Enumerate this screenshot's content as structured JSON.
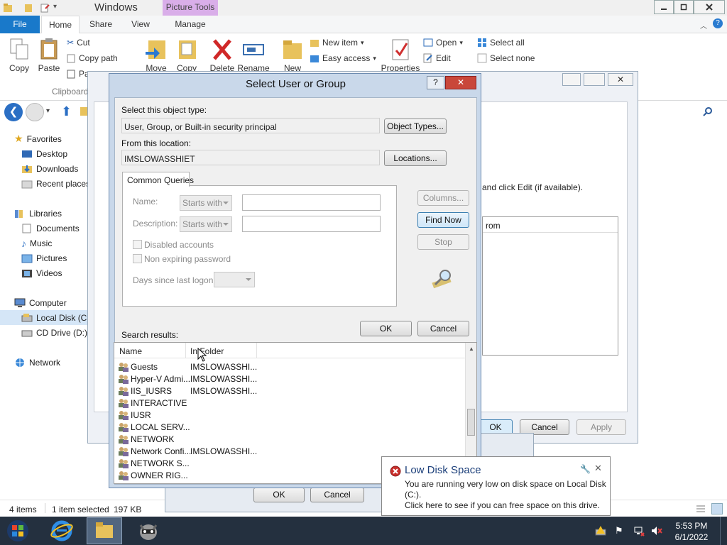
{
  "explorer": {
    "title": "Windows",
    "picture_tools": "Picture Tools",
    "tabs": [
      "File",
      "Home",
      "Share",
      "View",
      "Manage"
    ],
    "ribbon": {
      "copy": "Copy",
      "paste": "Paste",
      "cut": "Cut",
      "copy_path": "Copy path",
      "paste_shortcut": "Pa",
      "clipboard_group": "Clipboard",
      "move": "Move",
      "copy_to": "Copy",
      "delete": "Delete",
      "rename": "Rename",
      "new": "New",
      "new_item": "New item",
      "easy_access": "Easy access",
      "properties": "Properties",
      "open": "Open",
      "edit": "Edit",
      "select_all": "Select all",
      "select_none": "Select none"
    },
    "nav": {
      "favorites": "Favorites",
      "desktop": "Desktop",
      "downloads": "Downloads",
      "recent": "Recent places",
      "libraries": "Libraries",
      "documents": "Documents",
      "music": "Music",
      "pictures": "Pictures",
      "videos": "Videos",
      "computer": "Computer",
      "local_disk": "Local Disk (C:)",
      "cd_drive": "CD Drive (D:)",
      "network": "Network"
    },
    "status": {
      "items": "4 items",
      "selected": "1 item selected",
      "size": "197 KB"
    }
  },
  "props_window": {
    "instruction": "and click Edit (if available).",
    "column": "rom",
    "ok": "OK",
    "cancel": "Cancel",
    "apply": "Apply"
  },
  "adv_window": {
    "ok": "OK",
    "cancel": "Cancel"
  },
  "dialog": {
    "title": "Select User or Group",
    "object_type_label": "Select this object type:",
    "object_type_value": "User, Group, or Built-in security principal",
    "object_types_btn": "Object Types...",
    "location_label": "From this location:",
    "location_value": "IMSLOWASSHIET",
    "locations_btn": "Locations...",
    "queries_tab": "Common Queries",
    "name_label": "Name:",
    "desc_label": "Description:",
    "starts_with": "Starts with",
    "disabled_accounts": "Disabled accounts",
    "non_expiring": "Non expiring password",
    "days_label": "Days since last logon:",
    "columns_btn": "Columns...",
    "find_now_btn": "Find Now",
    "stop_btn": "Stop",
    "ok_btn": "OK",
    "cancel_btn": "Cancel",
    "results_label": "Search results:",
    "col_name": "Name",
    "col_folder": "In Folder",
    "rows": [
      {
        "name": "Guests",
        "folder": "IMSLOWASSHI..."
      },
      {
        "name": "Hyper-V Admi...",
        "folder": "IMSLOWASSHI..."
      },
      {
        "name": "IIS_IUSRS",
        "folder": "IMSLOWASSHI..."
      },
      {
        "name": "INTERACTIVE",
        "folder": ""
      },
      {
        "name": "IUSR",
        "folder": ""
      },
      {
        "name": "LOCAL SERV...",
        "folder": ""
      },
      {
        "name": "NETWORK",
        "folder": ""
      },
      {
        "name": "Network Confi...",
        "folder": "IMSLOWASSHI..."
      },
      {
        "name": "NETWORK S...",
        "folder": ""
      },
      {
        "name": "OWNER RIG...",
        "folder": ""
      }
    ]
  },
  "notification": {
    "title": "Low Disk Space",
    "line1": "You are running very low on disk space on Local Disk",
    "line2": "(C:).",
    "line3": "Click here to see if you can free space on this drive."
  },
  "taskbar": {
    "time": "5:53 PM",
    "date": "6/1/2022"
  },
  "colors": {
    "accent": "#1979ca",
    "taskbar": "#24303f",
    "picture_tools": "#d9aee9"
  }
}
